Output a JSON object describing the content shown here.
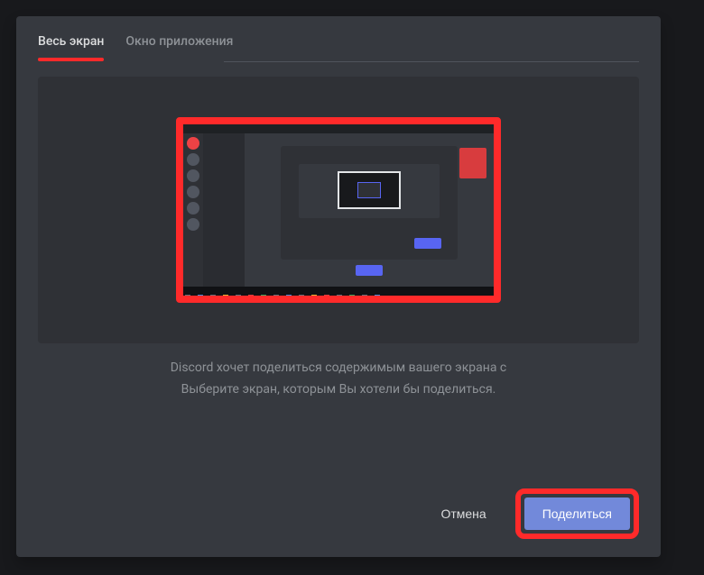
{
  "tabs": {
    "fullscreen": "Весь экран",
    "appwindow": "Окно приложения"
  },
  "description": {
    "line1": "Discord хочет поделиться содержимым вашего экрана с",
    "line2": "Выберите экран, которым Вы хотели бы поделиться."
  },
  "buttons": {
    "cancel": "Отмена",
    "share": "Поделиться"
  },
  "highlight_color": "#ff2a2a",
  "accent_color": "#7289da"
}
